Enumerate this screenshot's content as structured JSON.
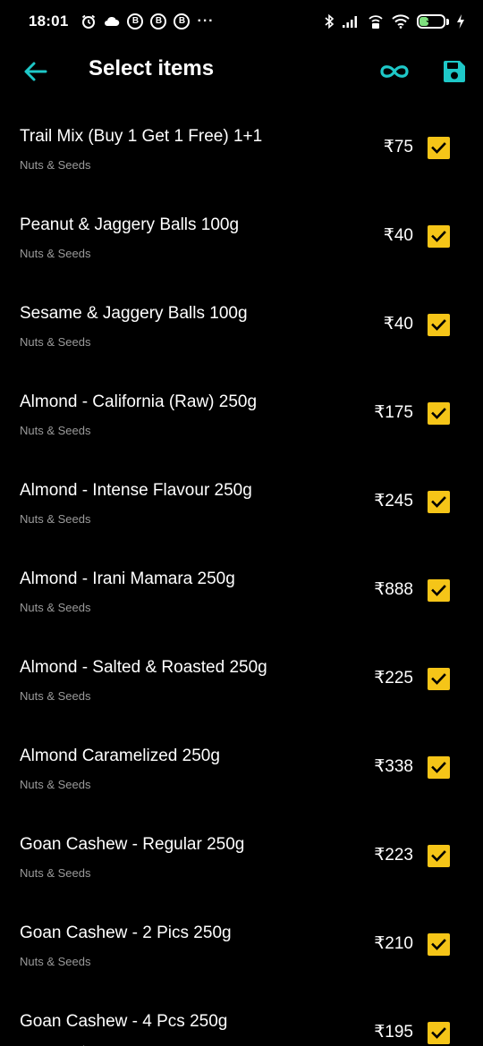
{
  "status_bar": {
    "time": "18:01",
    "battery_level": "39",
    "battery_fraction": 0.39,
    "left_icons": [
      "alarm-icon",
      "cloud-icon",
      "b-badge-icon",
      "b-badge-icon",
      "b-badge-icon",
      "more-dots-icon"
    ],
    "right_icons": [
      "bluetooth-icon",
      "signal-icon",
      "hotspot-icon",
      "wifi-icon",
      "battery-icon",
      "charging-icon"
    ],
    "badge_letter": "B",
    "dots": "···"
  },
  "app_bar": {
    "title": "Select items",
    "back_icon": "arrow-left-icon",
    "loop_icon": "infinity-icon",
    "save_icon": "floppy-disk-icon",
    "accent_color": "#1ec8c8"
  },
  "check_color": "#f5c518",
  "items": [
    {
      "name": "Trail Mix (Buy 1 Get 1 Free) 1+1",
      "category": "Nuts & Seeds",
      "price": "₹75",
      "checked": true
    },
    {
      "name": "Peanut & Jaggery Balls 100g",
      "category": "Nuts & Seeds",
      "price": "₹40",
      "checked": true
    },
    {
      "name": "Sesame & Jaggery Balls 100g",
      "category": "Nuts & Seeds",
      "price": "₹40",
      "checked": true
    },
    {
      "name": "Almond - California (Raw) 250g",
      "category": "Nuts & Seeds",
      "price": "₹175",
      "checked": true
    },
    {
      "name": "Almond - Intense Flavour 250g",
      "category": "Nuts & Seeds",
      "price": "₹245",
      "checked": true
    },
    {
      "name": "Almond - Irani Mamara 250g",
      "category": "Nuts & Seeds",
      "price": "₹888",
      "checked": true
    },
    {
      "name": "Almond - Salted & Roasted 250g",
      "category": "Nuts & Seeds",
      "price": "₹225",
      "checked": true
    },
    {
      "name": "Almond Caramelized 250g",
      "category": "Nuts & Seeds",
      "price": "₹338",
      "checked": true
    },
    {
      "name": "Goan Cashew - Regular 250g",
      "category": "Nuts & Seeds",
      "price": "₹223",
      "checked": true
    },
    {
      "name": "Goan Cashew - 2 Pics 250g",
      "category": "Nuts & Seeds",
      "price": "₹210",
      "checked": true
    },
    {
      "name": "Goan Cashew - 4 Pcs 250g",
      "category": "Nuts & Seeds",
      "price": "₹195",
      "checked": true
    }
  ]
}
